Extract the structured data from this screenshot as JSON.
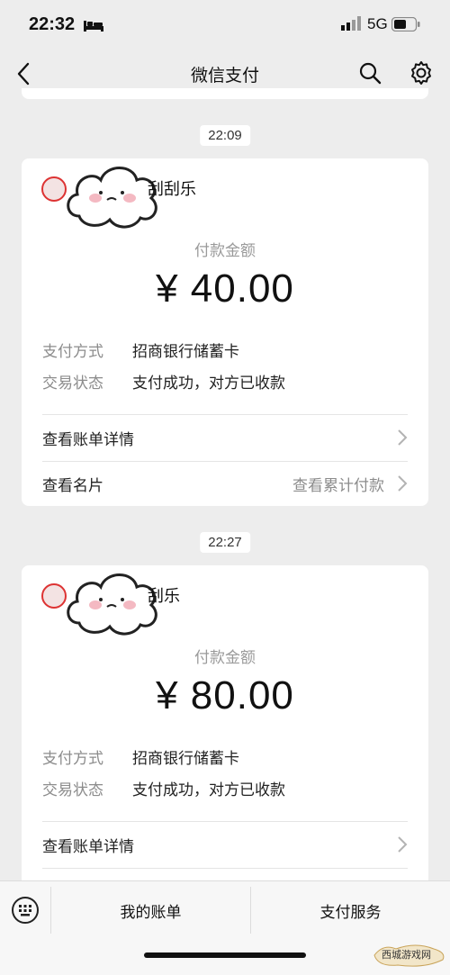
{
  "status_bar": {
    "time": "22:32",
    "network": "5G"
  },
  "nav": {
    "title": "微信支付"
  },
  "messages": [
    {
      "timestamp": "22:09",
      "merchant": "刮刮乐",
      "amount_label": "付款金额",
      "amount": "¥ 40.00",
      "pay_method_label": "支付方式",
      "pay_method": "招商银行储蓄卡",
      "status_label": "交易状态",
      "status": "支付成功，对方已收款",
      "detail_link": "查看账单详情",
      "card_link": "查看名片",
      "cumulative_link": "查看累计付款"
    },
    {
      "timestamp": "22:27",
      "merchant": "刮乐",
      "amount_label": "付款金额",
      "amount": "¥ 80.00",
      "pay_method_label": "支付方式",
      "pay_method": "招商银行储蓄卡",
      "status_label": "交易状态",
      "status": "支付成功，对方已收款",
      "detail_link": "查看账单详情"
    }
  ],
  "bottom_bar": {
    "tab1": "我的账单",
    "tab2": "支付服务"
  },
  "watermark": {
    "text": "西城游戏网"
  },
  "colors": {
    "background": "#ededed",
    "card": "#ffffff",
    "muted": "#8c8c8c"
  }
}
